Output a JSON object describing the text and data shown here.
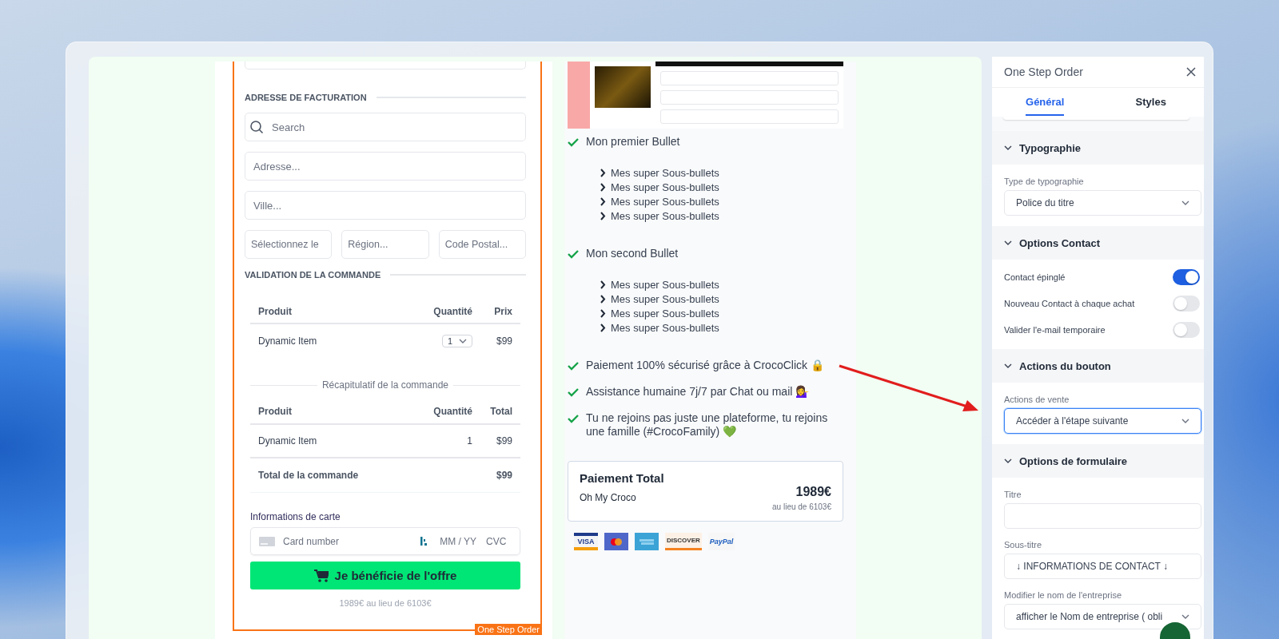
{
  "form": {
    "billing_heading": "ADRESSE DE FACTURATION",
    "fields": [
      {
        "kind": "search",
        "placeholder": "Search"
      },
      {
        "kind": "text",
        "placeholder": "Adresse..."
      },
      {
        "kind": "text",
        "placeholder": "Ville..."
      }
    ],
    "address_row": [
      {
        "placeholder": "Sélectionnez le"
      },
      {
        "placeholder": "Région..."
      },
      {
        "placeholder": "Code Postal..."
      }
    ],
    "validation_heading": "VALIDATION DE LA COMMANDE",
    "order_table": {
      "columns": [
        "Produit",
        "Quantité",
        "Prix"
      ],
      "rows": [
        {
          "product": "Dynamic Item",
          "quantity": "1",
          "price": "$99"
        }
      ]
    },
    "summary_heading": "Récapitulatif de la commande",
    "summary_table": {
      "columns": [
        "Produit",
        "Quantité",
        "Total"
      ],
      "rows": [
        {
          "product": "Dynamic Item",
          "quantity": "1",
          "total": "$99"
        }
      ],
      "total_label": "Total de la commande",
      "total_value": "$99"
    },
    "card_label": "Informations de carte",
    "card_field": {
      "card_number": {
        "placeholder": "Card number"
      },
      "expiry": {
        "placeholder": "MM / YY"
      },
      "cvc": {
        "placeholder": "CVC"
      }
    },
    "submit_button": "Je bénéficie de l'offre",
    "price_note": "1989€ au lieu de 6103€",
    "tag": "One Step Order"
  },
  "content": {
    "bullets": [
      {
        "kind": "main",
        "text": "Mon premier Bullet",
        "children": [
          {
            "text": "Mes super Sous-bullets"
          },
          {
            "text": "Mes super Sous-bullets"
          },
          {
            "text": "Mes super Sous-bullets"
          },
          {
            "text": "Mes super Sous-bullets"
          }
        ]
      },
      {
        "kind": "main",
        "text": "Mon second Bullet",
        "children": [
          {
            "text": "Mes super Sous-bullets"
          },
          {
            "text": "Mes super Sous-bullets"
          },
          {
            "text": "Mes super Sous-bullets"
          },
          {
            "text": "Mes super Sous-bullets"
          }
        ]
      },
      {
        "kind": "feature",
        "text": "Paiement 100% sécurisé grâce à CrocoClick 🔒"
      },
      {
        "kind": "feature",
        "text": "Assistance humaine 7j/7 par Chat ou mail 💁‍♀️"
      },
      {
        "kind": "feature",
        "text": "Tu ne rejoins pas juste une plateforme, tu rejoins une famille (#CrocoFamily) 💚"
      }
    ],
    "payment": {
      "title": "Paiement Total",
      "product": "Oh My Croco",
      "price": "1989€",
      "old_price": "au lieu de 6103€"
    },
    "card_logos": [
      {
        "kind": "visa",
        "label": "VISA"
      },
      {
        "kind": "mastercard"
      },
      {
        "kind": "amex"
      },
      {
        "kind": "discover",
        "label": "DISCOVER"
      },
      {
        "kind": "paypal",
        "label": "PayPal"
      }
    ]
  },
  "panel": {
    "title": "One Step Order",
    "tabs": [
      {
        "label": "Général",
        "selected": true
      },
      {
        "label": "Styles",
        "selected": false
      }
    ],
    "sections": [
      {
        "title": "Typographie",
        "expanded": true,
        "items": [
          {
            "kind": "select",
            "label": "Type de typographie",
            "value": "Police du titre",
            "focused": false
          }
        ]
      },
      {
        "title": "Options Contact",
        "expanded": true,
        "items": [
          {
            "kind": "toggle",
            "label": "Contact épinglé",
            "on": true
          },
          {
            "kind": "toggle",
            "label": "Nouveau Contact à chaque achat",
            "on": false
          },
          {
            "kind": "toggle",
            "label": "Valider l'e-mail temporaire",
            "on": false
          }
        ]
      },
      {
        "title": "Actions du bouton",
        "expanded": true,
        "items": [
          {
            "kind": "select",
            "label": "Actions de vente",
            "value": "Accéder à l'étape suivante",
            "focused": true
          }
        ]
      },
      {
        "title": "Options de formulaire",
        "expanded": true,
        "items": [
          {
            "kind": "text",
            "label": "Titre"
          },
          {
            "kind": "text",
            "label": "Sous-titre",
            "value": "↓ INFORMATIONS DE CONTACT ↓"
          },
          {
            "kind": "select",
            "label": "Modifier le nom de l'entreprise",
            "value": "afficher le Nom de entreprise ( obli",
            "focused": false
          }
        ]
      }
    ]
  }
}
